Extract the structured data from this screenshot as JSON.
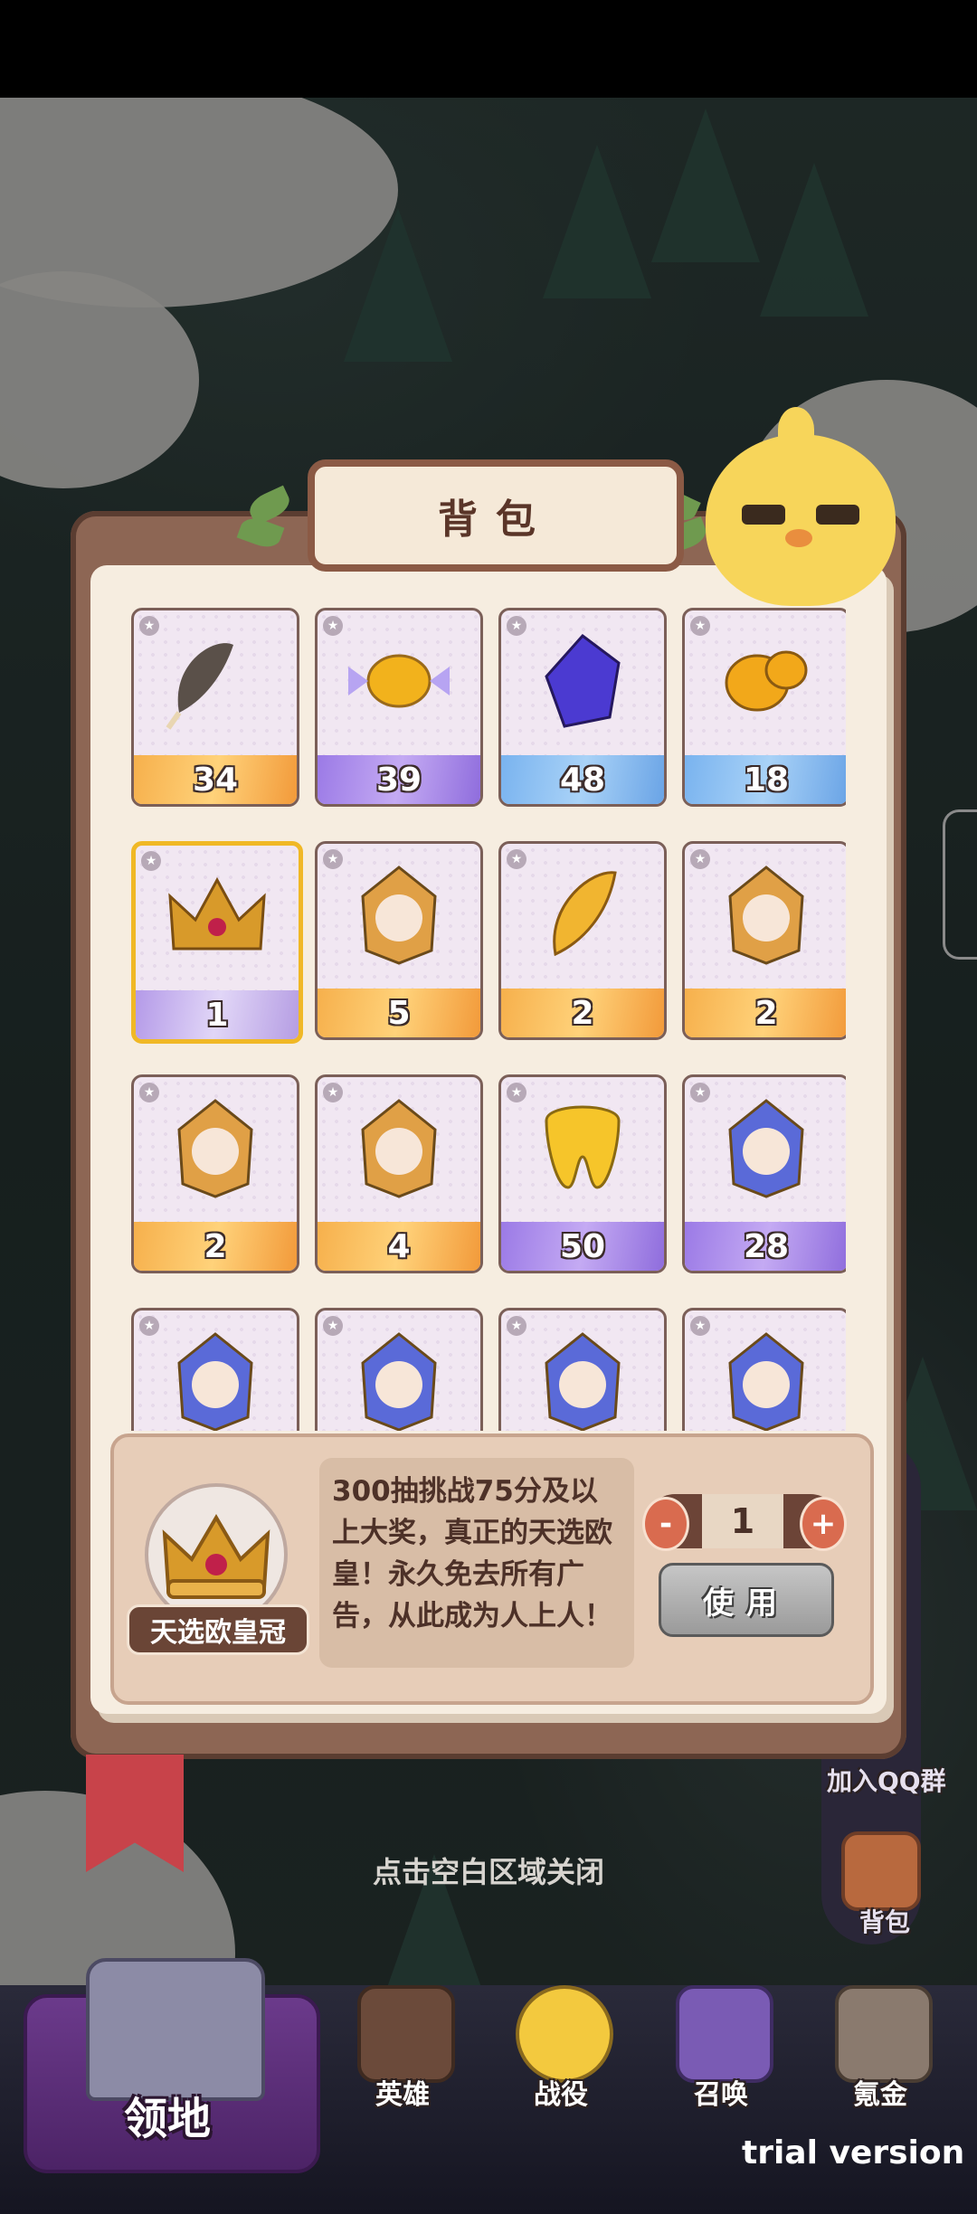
{
  "window": {
    "title": "背包"
  },
  "items": [
    {
      "count": "34",
      "rarity": "orange",
      "icon": "feather-icon",
      "color": "#5a5049"
    },
    {
      "count": "39",
      "rarity": "purple",
      "icon": "candy-icon",
      "color": "#f2b21c"
    },
    {
      "count": "48",
      "rarity": "blue",
      "icon": "crystal-icon",
      "color": "#4b3ad1"
    },
    {
      "count": "18",
      "rarity": "blue",
      "icon": "gold-nugget-icon",
      "color": "#f2a81a"
    },
    {
      "count": "1",
      "rarity": "lilac",
      "icon": "crown-icon",
      "color": "#d89a2a",
      "selected": true
    },
    {
      "count": "5",
      "rarity": "orange",
      "icon": "hero-portrait-icon",
      "color": "#e0a046"
    },
    {
      "count": "2",
      "rarity": "orange",
      "icon": "golden-feather-icon",
      "color": "#f1b530"
    },
    {
      "count": "2",
      "rarity": "orange",
      "icon": "hero-portrait-icon",
      "color": "#e0a046"
    },
    {
      "count": "2",
      "rarity": "orange",
      "icon": "hero-portrait-icon",
      "color": "#e0a046"
    },
    {
      "count": "4",
      "rarity": "orange",
      "icon": "hero-portrait-icon",
      "color": "#e0a046"
    },
    {
      "count": "50",
      "rarity": "purple",
      "icon": "golden-tooth-icon",
      "color": "#f6c52a"
    },
    {
      "count": "28",
      "rarity": "purple",
      "icon": "hero-portrait-icon",
      "color": "#5a6ad8"
    },
    {
      "count": "",
      "rarity": "purple",
      "icon": "hero-portrait-icon",
      "color": "#5a6ad8"
    },
    {
      "count": "",
      "rarity": "purple",
      "icon": "hero-portrait-icon",
      "color": "#5a6ad8"
    },
    {
      "count": "",
      "rarity": "purple",
      "icon": "hero-portrait-icon",
      "color": "#5a6ad8"
    },
    {
      "count": "",
      "rarity": "purple",
      "icon": "hero-portrait-icon",
      "color": "#5a6ad8"
    }
  ],
  "detail": {
    "name": "天选欧皇冠",
    "description": "300抽挑战75分及以上大奖，真正的天选欧皇！永久免去所有广告，从此成为人上人！",
    "quantity": "1",
    "minus_label": "-",
    "plus_label": "+",
    "use_label": "使用"
  },
  "close_hint": "点击空白区域关闭",
  "side": {
    "qq_label": "加入QQ群",
    "bag_label": "背包"
  },
  "nav": {
    "home": "领地",
    "items": [
      "英雄",
      "战役",
      "召唤",
      "氪金"
    ]
  },
  "watermark": "trial version",
  "colors": {
    "accent_gold": "#f0b826",
    "panel_brown": "#8d6654",
    "paper": "#f6ede0"
  }
}
